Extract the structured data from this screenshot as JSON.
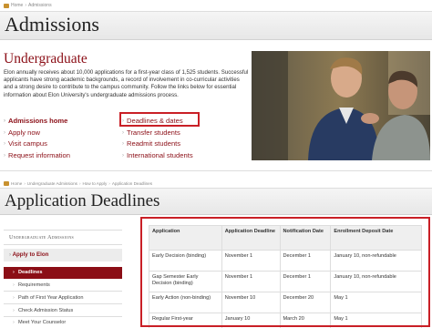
{
  "top": {
    "breadcrumb": {
      "home": "Home",
      "current": "Admissions"
    },
    "title": "Admissions",
    "section_heading": "Undergraduate",
    "intro": "Elon annually receives about 10,000 applications for a first-year class of 1,525 students. Successful applicants have strong academic backgrounds, a record of involvement in co-curricular activities and a strong desire to contribute to the campus community. Follow the links below for essential information about Elon University's undergraduate admissions process.",
    "links_left": [
      "Admissions home",
      "Apply now",
      "Visit campus",
      "Request information"
    ],
    "links_right": [
      "Deadlines & dates",
      "Transfer students",
      "Readmit students",
      "International students"
    ]
  },
  "bottom": {
    "breadcrumb": {
      "home": "Home",
      "level1": "Undergraduate Admissions",
      "level2": "How to Apply",
      "current": "Application Deadlines"
    },
    "title": "Application Deadlines",
    "sidebar": {
      "title": "Undergraduate Admissions",
      "parent": "Apply to Elon",
      "items": [
        "Deadlines",
        "Requirements",
        "Path of First Year Application",
        "Check Admission Status",
        "Meet Your Counselor"
      ]
    },
    "table": {
      "headers": [
        "Application",
        "Application Deadline",
        "Notification Date",
        "Enrollment Deposit Date"
      ],
      "rows": [
        [
          "Early Decision (binding)",
          "November 1",
          "December 1",
          "January 10, non-refundable"
        ],
        [
          "Gap Semester Early Decision (binding)",
          "November 1",
          "December 1",
          "January 10, non-refundable"
        ],
        [
          "Early Action (non-binding)",
          "November 10",
          "December 20",
          "May 1"
        ],
        [
          "Regular First-year",
          "January 10",
          "March 20",
          "May 1"
        ]
      ]
    }
  },
  "colors": {
    "brand": "#8b0e16",
    "highlight": "#c91f26"
  },
  "icons": [
    "home-icon",
    "chevron-right-icon"
  ]
}
